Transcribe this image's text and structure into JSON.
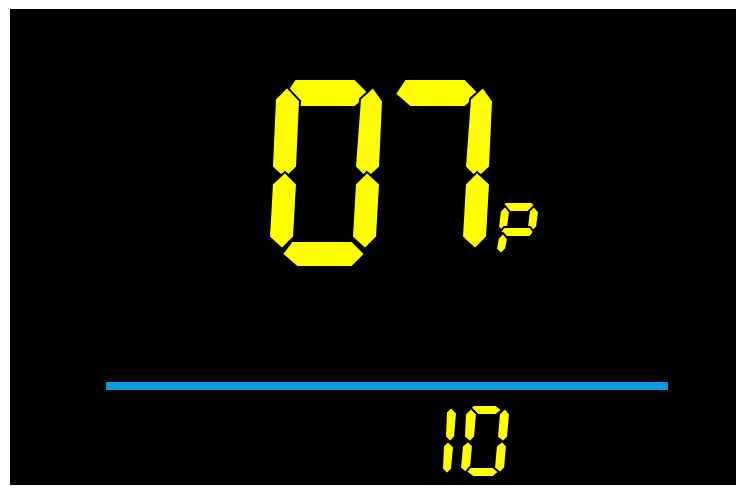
{
  "display": {
    "main_value": "07",
    "unit": "p",
    "sub_value": "10"
  },
  "colors": {
    "background": "#000000",
    "segment_on": "#ffff00",
    "divider": "#0a9ae0",
    "frame": "#ffffff"
  }
}
